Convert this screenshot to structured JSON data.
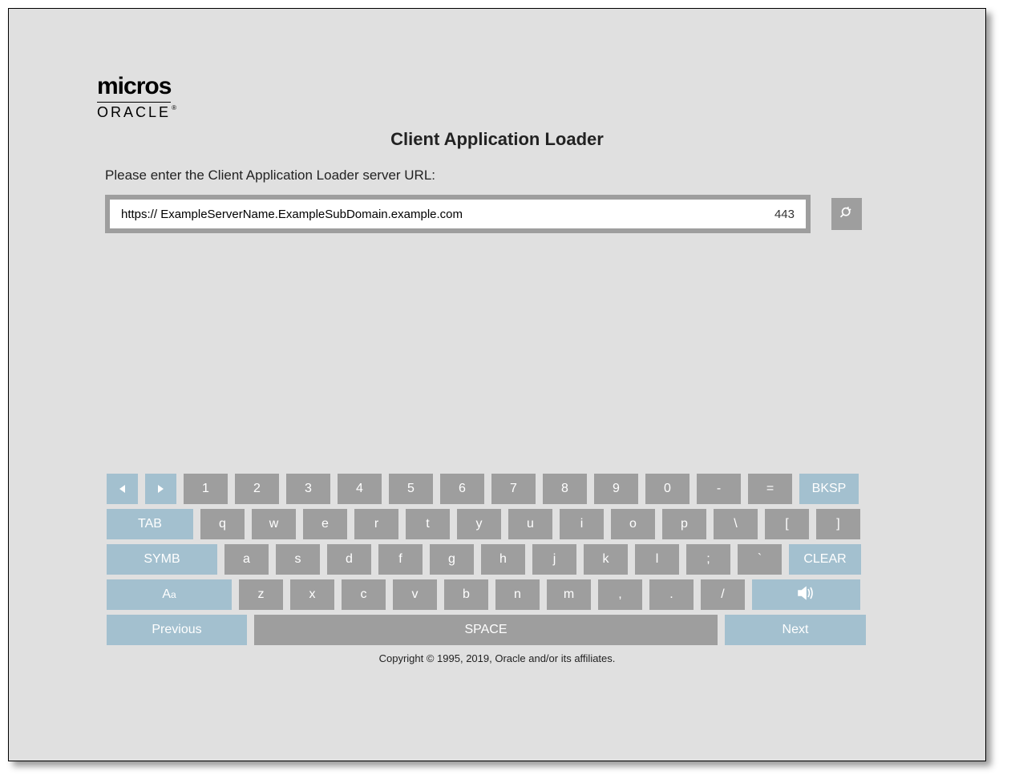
{
  "logo": {
    "top": "micros",
    "bottom": "ORACLE"
  },
  "title": "Client Application Loader",
  "prompt": "Please enter the Client Application Loader server URL:",
  "url": {
    "value": "https:// ExampleServerName.ExampleSubDomain.example.com",
    "port": "443"
  },
  "keyboard": {
    "row1": {
      "nums": [
        "1",
        "2",
        "3",
        "4",
        "5",
        "6",
        "7",
        "8",
        "9",
        "0",
        "-",
        "="
      ],
      "bksp": "BKSP"
    },
    "row2": {
      "tab": "TAB",
      "keys": [
        "q",
        "w",
        "e",
        "r",
        "t",
        "y",
        "u",
        "i",
        "o",
        "p",
        "\\",
        "[",
        "]"
      ]
    },
    "row3": {
      "symb": "SYMB",
      "keys": [
        "a",
        "s",
        "d",
        "f",
        "g",
        "h",
        "j",
        "k",
        "l",
        ";",
        "`"
      ],
      "clear": "CLEAR"
    },
    "row4": {
      "caps_big": "A",
      "caps_small": "a",
      "keys": [
        "z",
        "x",
        "c",
        "v",
        "b",
        "n",
        "m",
        ",",
        ".",
        "/"
      ]
    },
    "row5": {
      "prev": "Previous",
      "space": "SPACE",
      "next": "Next"
    }
  },
  "copyright": "Copyright © 1995, 2019, Oracle and/or its affiliates."
}
